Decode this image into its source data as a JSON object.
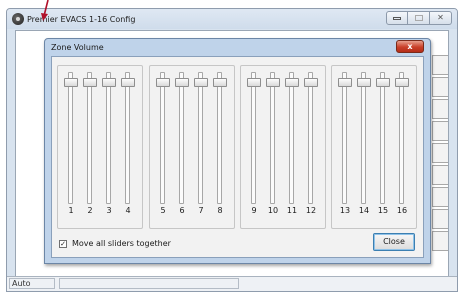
{
  "main_window": {
    "title": "Premier EVACS 1-16 Config",
    "status_text": "Auto"
  },
  "dialog": {
    "title": "Zone Volume",
    "close_glyph": "x",
    "move_all_label": "Move all sliders together",
    "move_all_checked": true,
    "close_button_label": "Close"
  },
  "zones": [
    {
      "label": "1",
      "level": 0.95
    },
    {
      "label": "2",
      "level": 0.95
    },
    {
      "label": "3",
      "level": 0.95
    },
    {
      "label": "4",
      "level": 0.95
    },
    {
      "label": "5",
      "level": 0.95
    },
    {
      "label": "6",
      "level": 0.95
    },
    {
      "label": "7",
      "level": 0.95
    },
    {
      "label": "8",
      "level": 0.95
    },
    {
      "label": "9",
      "level": 0.95
    },
    {
      "label": "10",
      "level": 0.95
    },
    {
      "label": "11",
      "level": 0.95
    },
    {
      "label": "12",
      "level": 0.95
    },
    {
      "label": "13",
      "level": 0.95
    },
    {
      "label": "14",
      "level": 0.95
    },
    {
      "label": "15",
      "level": 0.95
    },
    {
      "label": "16",
      "level": 0.95
    }
  ],
  "colors": {
    "pointer": "#b0102a",
    "dialog_frame": "#bfd3ea",
    "close_red": "#c9402a",
    "logo_blue": "#1a6fb8"
  }
}
